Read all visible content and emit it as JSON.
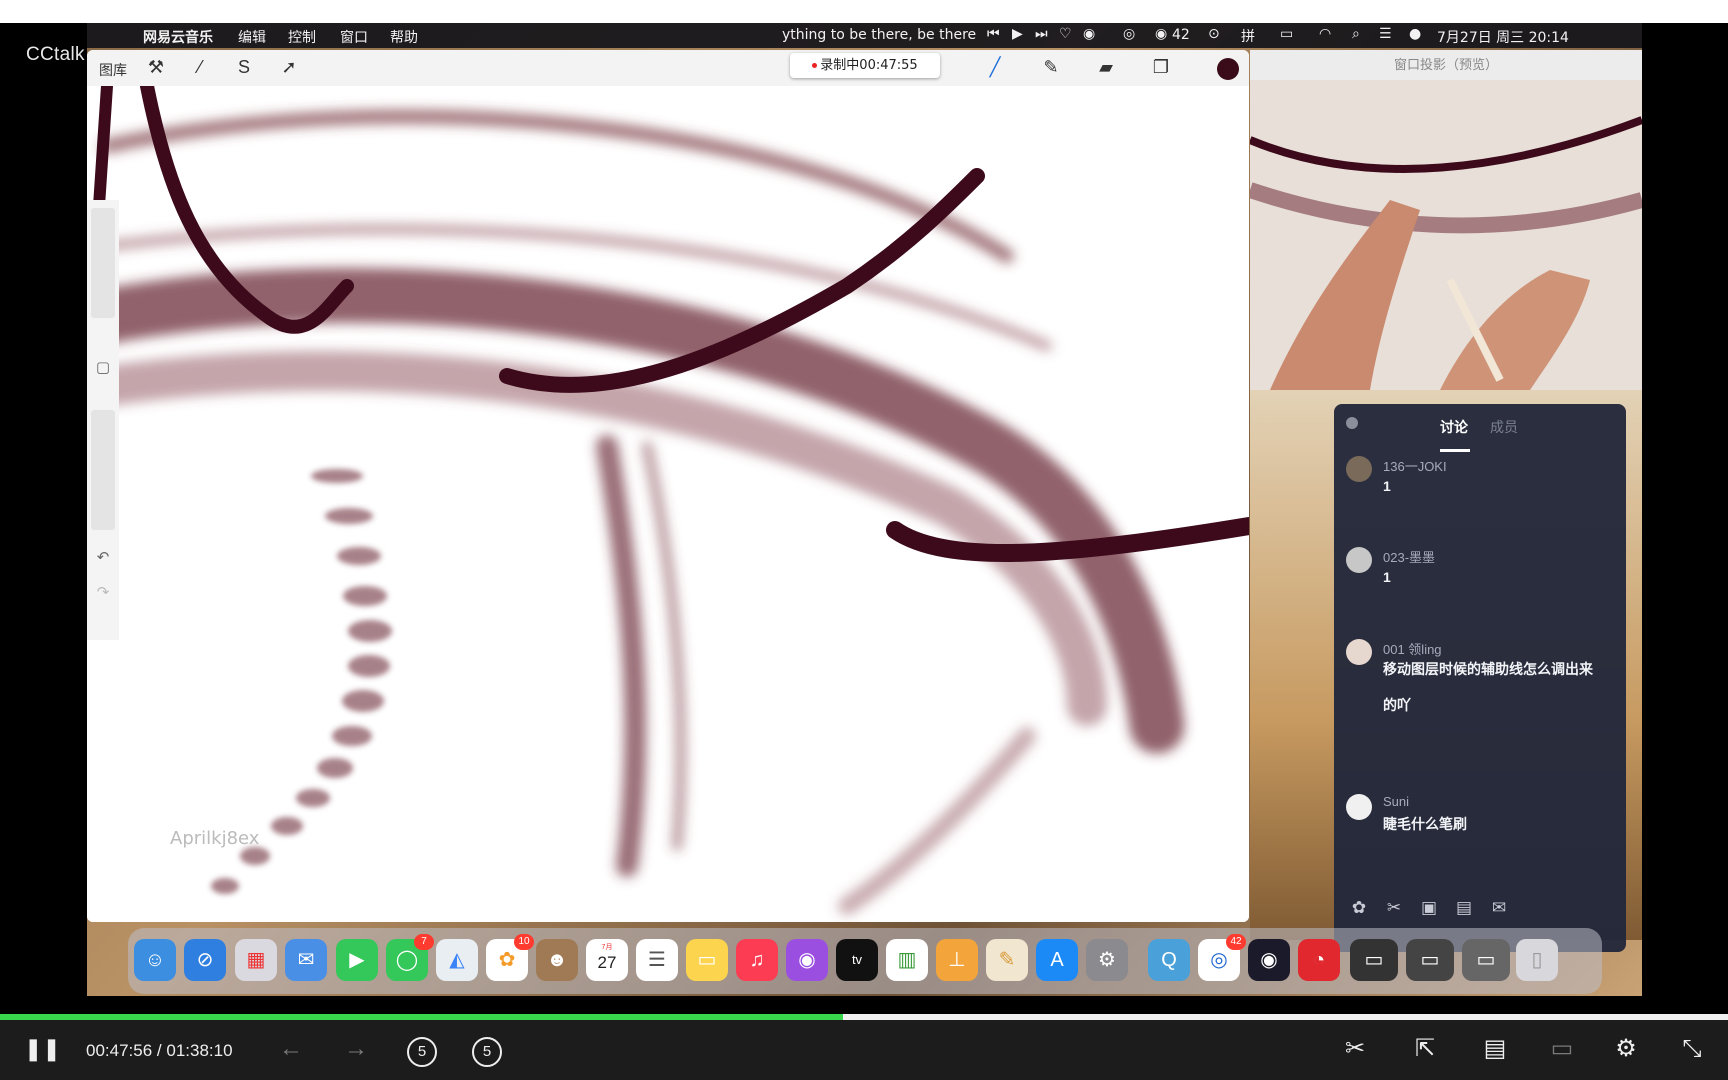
{
  "app": {
    "brand": "CCtalk"
  },
  "menubar": {
    "items": [
      "网易云音乐",
      "编辑",
      "控制",
      "窗口",
      "帮助"
    ],
    "now_playing": "ything to be there, be there",
    "counter": "42",
    "datetime": "7月27日 周三  20:14"
  },
  "procreate": {
    "gallery_label": "图库",
    "recording": "录制中00:47:55",
    "watermark": "Aprilkj8ex",
    "brush_color": "#3a0b18"
  },
  "projection": {
    "title": "窗口投影（预览）"
  },
  "chat": {
    "tabs": [
      "讨论",
      "成员"
    ],
    "messages": [
      {
        "user": "136一JOKI",
        "text": "1"
      },
      {
        "user": "023-墨墨",
        "text": "1"
      },
      {
        "user": "001 领ling",
        "text": "移动图层时候的辅助线怎么调出来的吖"
      },
      {
        "user": "Suni",
        "text": "睫毛什么笔刷"
      }
    ]
  },
  "dock": {
    "messages_badge": "7",
    "photos_badge": "10",
    "calendar_date": "27",
    "calendar_month": "7月",
    "chrome_badge": "42"
  },
  "player": {
    "current_time": "00:47:56",
    "separator": "/",
    "total_time": "01:38:10",
    "progress": 0.488,
    "skip_back": "5",
    "skip_forward": "5"
  },
  "icons": {
    "apple": "apple-logo-icon",
    "pause": "pause-icon",
    "scissors": "scissors-icon",
    "settings": "gear-icon",
    "exit_fullscreen": "exit-fullscreen-icon"
  }
}
